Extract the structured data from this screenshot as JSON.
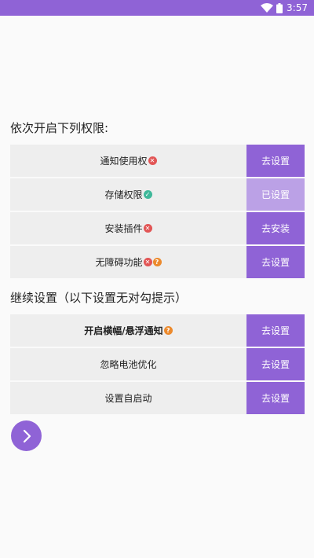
{
  "status_bar": {
    "time": "3:57",
    "color": "#8f63d6",
    "icons": [
      "wifi-icon",
      "battery-icon"
    ]
  },
  "required_section": {
    "title": "依次开启下列权限:",
    "items": [
      {
        "label": "通知使用权",
        "status": "error",
        "action": "去设置"
      },
      {
        "label": "存储权限",
        "status": "granted",
        "action": "已设置"
      },
      {
        "label": "安装插件",
        "status": "error",
        "action": "去安装"
      },
      {
        "label": "无障碍功能",
        "status": "error-help",
        "action": "去设置"
      }
    ]
  },
  "optional_section": {
    "title": "继续设置（以下设置无对勾提示）",
    "items": [
      {
        "label": "开启横幅/悬浮通知",
        "status": "help",
        "action": "去设置"
      },
      {
        "label": "忽略电池优化",
        "status": "none",
        "action": "去设置"
      },
      {
        "label": "设置自启动",
        "status": "none",
        "action": "去设置"
      }
    ]
  },
  "colors": {
    "accent": "#8f63d6",
    "accent_disabled": "#bba1e6",
    "error": "#e25555",
    "success": "#3fb89a",
    "help": "#ec8a2d"
  }
}
